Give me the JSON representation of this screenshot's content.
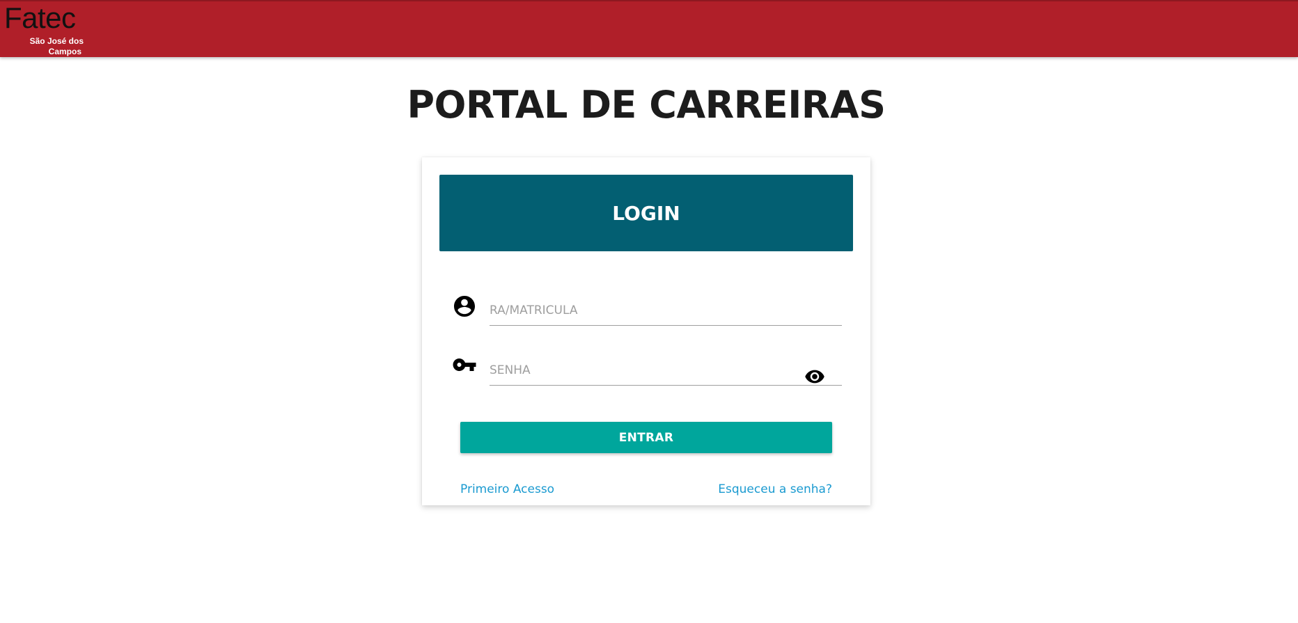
{
  "header": {
    "logo_name": "Fatec",
    "logo_subtitle_line1": "São José dos",
    "logo_subtitle_line2": "Campos",
    "background_color": "#b01f29"
  },
  "main": {
    "title": "PORTAL DE CARREIRAS"
  },
  "login_card": {
    "header_label": "LOGIN",
    "header_color": "#035f72",
    "ra_field": {
      "icon": "account-circle-icon",
      "placeholder": "RA/MATRICULA",
      "value": ""
    },
    "password_field": {
      "icon": "key-icon",
      "placeholder": "SENHA",
      "value": "",
      "toggle_icon": "eye-icon"
    },
    "submit_label": "ENTRAR",
    "submit_color": "#00a69c",
    "first_access_label": "Primeiro Acesso",
    "forgot_password_label": "Esqueceu a senha?",
    "link_color": "#1a9ad0"
  }
}
